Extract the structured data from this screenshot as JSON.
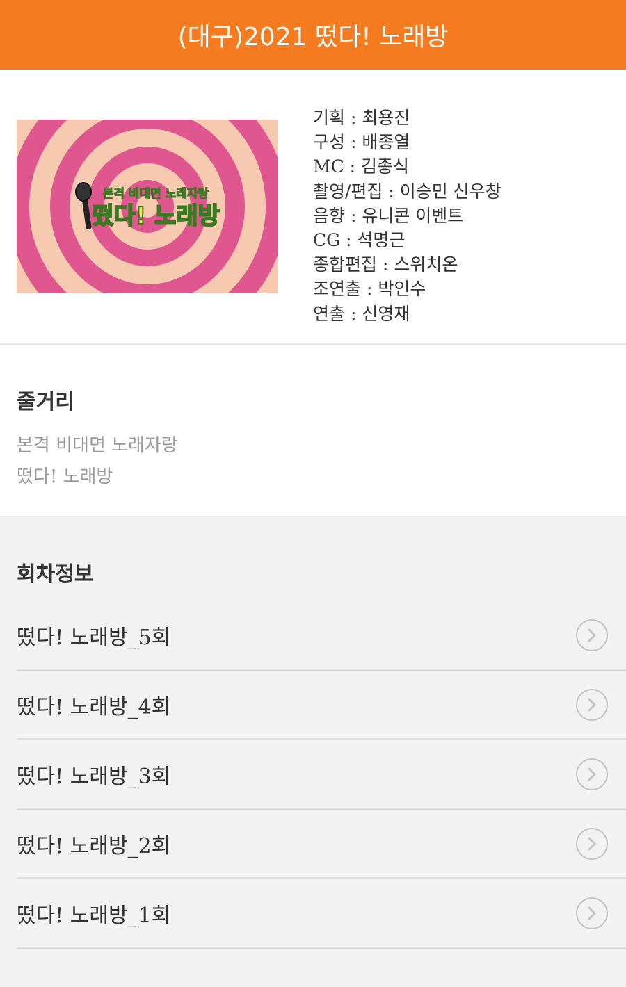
{
  "header": {
    "title": "(대구)2021 떴다! 노래방"
  },
  "poster": {
    "small_text": "본격 비대면 노래자랑",
    "big_text": "떴다! 노래방",
    "colors": {
      "pink": "#e0568f",
      "cream": "#f6c9b0",
      "yellow": "#f5e642",
      "green": "#5b9e3a"
    }
  },
  "credits": [
    "기획 : 최용진",
    "구성 : 배종열",
    "MC : 김종식",
    "촬영/편집 : 이승민 신우창",
    "음향 : 유니콘 이벤트",
    "CG : 석명근",
    "종합편집 : 스위치온",
    "조연출 : 박인수",
    "연출 : 신영재"
  ],
  "synopsis": {
    "title": "줄거리",
    "lines": [
      "본격 비대면 노래자랑",
      "떴다! 노래방"
    ]
  },
  "episodes": {
    "title": "회차정보",
    "items": [
      {
        "label": "떴다! 노래방_5회"
      },
      {
        "label": "떴다! 노래방_4회"
      },
      {
        "label": "떴다! 노래방_3회"
      },
      {
        "label": "떴다! 노래방_2회"
      },
      {
        "label": "떴다! 노래방_1회"
      }
    ]
  },
  "colors": {
    "accent": "#f47b20",
    "chevron": "#c4c4c4"
  }
}
